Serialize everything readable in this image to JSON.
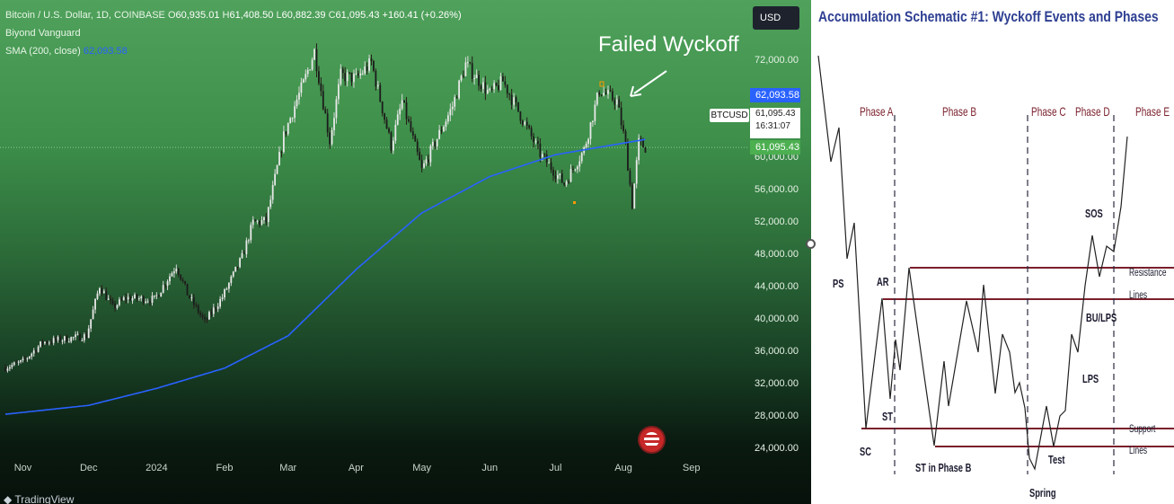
{
  "legend": {
    "symbol_line": "Bitcoin / U.S. Dollar, 1D, COINBASE",
    "open_label": "O",
    "open": "60,935.01",
    "high_label": "H",
    "high": "61,408.50",
    "low_label": "L",
    "low": "60,882.39",
    "close_label": "C",
    "close": "61,095.43",
    "change": "+160.41 (+0.26%)",
    "indicator_1": "Biyond Vanguard",
    "indicator_2": "SMA (200, close)",
    "sma_value": "62,093.58"
  },
  "currency_button": "USD",
  "price_scale": {
    "sma_tag": "62,093.58",
    "symbol": "BTCUSD",
    "last_price": "61,095.43",
    "countdown": "16:31:07",
    "close_tag": "61,095.43"
  },
  "annotation": "Failed Wyckoff",
  "branding": "TradingView",
  "colors": {
    "sma": "#2962ff",
    "up_candle": "#e8e8e8",
    "down_candle": "#1b1b1b",
    "tag_blue": "#2962ff",
    "tag_green": "#4caf50"
  },
  "chart_data": {
    "type": "candlestick",
    "title": "Bitcoin / U.S. Dollar, 1D, COINBASE",
    "y_axis_ticks": [
      "72,000.00",
      "68,000.00",
      "64,000.00",
      "60,000.00",
      "56,000.00",
      "52,000.00",
      "48,000.00",
      "44,000.00",
      "40,000.00",
      "36,000.00",
      "32,000.00",
      "28,000.00",
      "24,000.00"
    ],
    "x_axis_ticks": [
      "Nov",
      "Dec",
      "2024",
      "Feb",
      "Mar",
      "Apr",
      "May",
      "Jun",
      "Jul",
      "Aug",
      "Sep"
    ],
    "ylim": [
      22000,
      76000
    ],
    "price_path": [
      [
        "2023-10-24",
        33900
      ],
      [
        "2023-11-01",
        34600
      ],
      [
        "2023-11-10",
        37000
      ],
      [
        "2023-11-20",
        37400
      ],
      [
        "2023-11-30",
        37800
      ],
      [
        "2023-12-06",
        44000
      ],
      [
        "2023-12-12",
        41300
      ],
      [
        "2023-12-18",
        42500
      ],
      [
        "2023-12-31",
        42300
      ],
      [
        "2024-01-10",
        46500
      ],
      [
        "2024-01-15",
        43000
      ],
      [
        "2024-01-23",
        39500
      ],
      [
        "2024-01-31",
        42600
      ],
      [
        "2024-02-09",
        47500
      ],
      [
        "2024-02-14",
        51800
      ],
      [
        "2024-02-20",
        52000
      ],
      [
        "2024-02-28",
        62500
      ],
      [
        "2024-03-05",
        67000
      ],
      [
        "2024-03-08",
        69000
      ],
      [
        "2024-03-13",
        73000
      ],
      [
        "2024-03-20",
        61900
      ],
      [
        "2024-03-25",
        70000
      ],
      [
        "2024-04-01",
        69600
      ],
      [
        "2024-04-08",
        71600
      ],
      [
        "2024-04-17",
        61300
      ],
      [
        "2024-04-22",
        66800
      ],
      [
        "2024-05-01",
        58300
      ],
      [
        "2024-05-15",
        66200
      ],
      [
        "2024-05-21",
        71400
      ],
      [
        "2024-06-01",
        67700
      ],
      [
        "2024-06-07",
        69300
      ],
      [
        "2024-06-24",
        60300
      ],
      [
        "2024-07-05",
        56600
      ],
      [
        "2024-07-14",
        60800
      ],
      [
        "2024-07-21",
        68200
      ],
      [
        "2024-07-29",
        66800
      ],
      [
        "2024-08-02",
        61400
      ],
      [
        "2024-08-05",
        54000
      ],
      [
        "2024-08-08",
        61700
      ],
      [
        "2024-08-11",
        61095
      ]
    ],
    "sma_200_path": [
      [
        "2023-10-24",
        28100
      ],
      [
        "2023-12-01",
        29200
      ],
      [
        "2024-01-01",
        31300
      ],
      [
        "2024-02-01",
        33800
      ],
      [
        "2024-03-01",
        37800
      ],
      [
        "2024-04-01",
        46000
      ],
      [
        "2024-05-01",
        53000
      ],
      [
        "2024-06-01",
        57500
      ],
      [
        "2024-07-01",
        60200
      ],
      [
        "2024-08-11",
        62093.58
      ]
    ]
  },
  "schematic": {
    "title": "Accumulation Schematic #1: Wyckoff Events and Phases",
    "phases": [
      "Phase A",
      "Phase B",
      "Phase C",
      "Phase D",
      "Phase E"
    ],
    "events": [
      "PS",
      "AR",
      "ST",
      "SC",
      "ST in Phase B",
      "Spring",
      "Test",
      "LPS",
      "BU/LPS",
      "SOS"
    ],
    "line_labels": [
      "Resistance",
      "Lines",
      "Support",
      "Lines"
    ]
  }
}
